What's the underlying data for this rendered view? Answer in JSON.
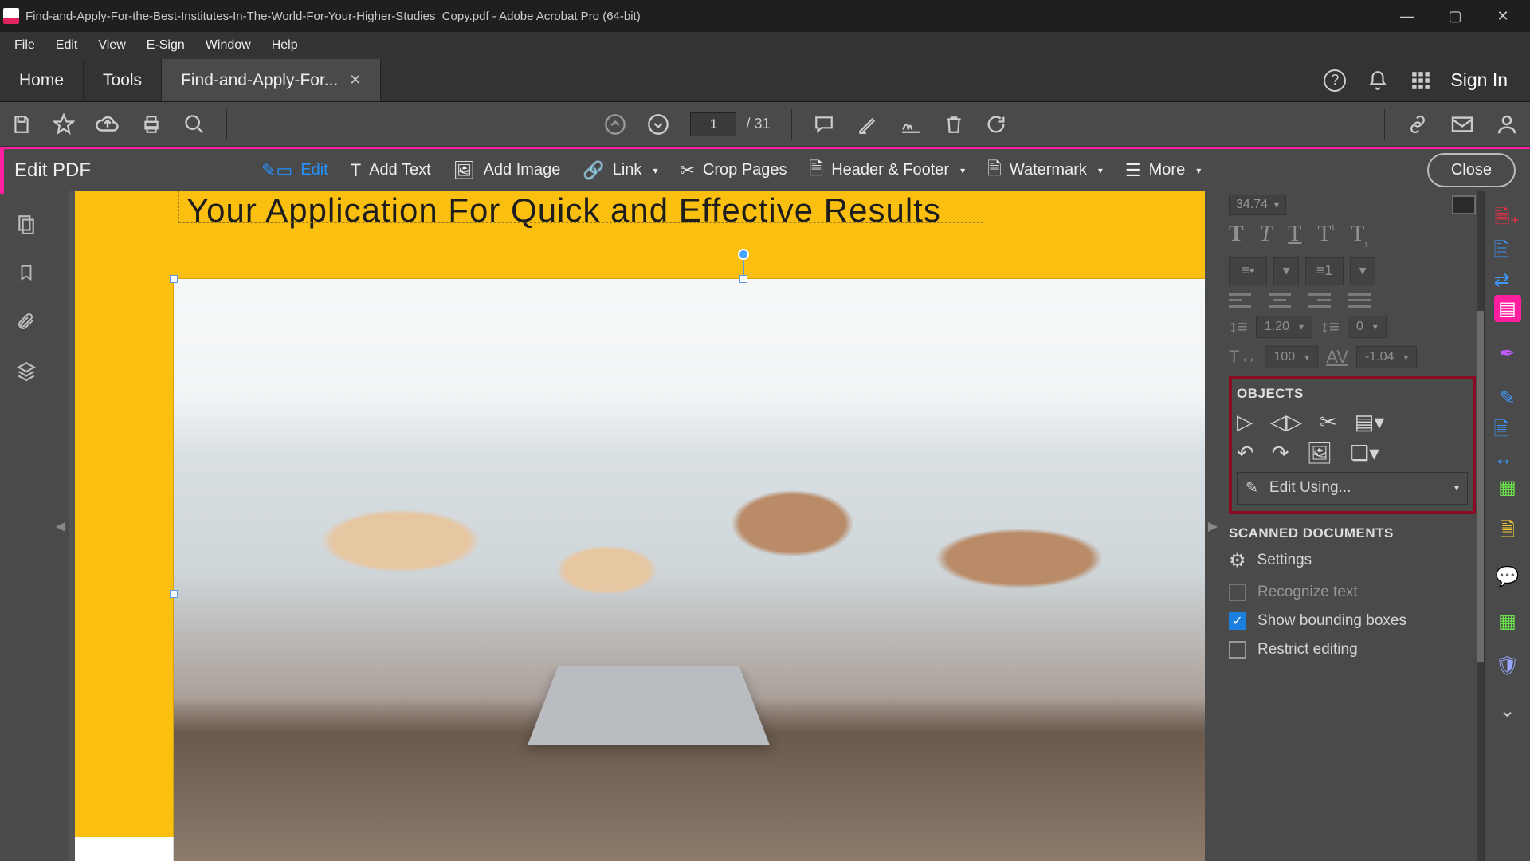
{
  "title": "Find-and-Apply-For-the-Best-Institutes-In-The-World-For-Your-Higher-Studies_Copy.pdf - Adobe Acrobat Pro (64-bit)",
  "menu": {
    "file": "File",
    "edit": "Edit",
    "view": "View",
    "esign": "E-Sign",
    "window": "Window",
    "help": "Help"
  },
  "tabs": {
    "home": "Home",
    "tools": "Tools",
    "doc": "Find-and-Apply-For..."
  },
  "sign_in": "Sign In",
  "page": {
    "current": "1",
    "total": "/ 31"
  },
  "editstrip": {
    "title": "Edit PDF",
    "edit": "Edit",
    "add_text": "Add Text",
    "add_image": "Add Image",
    "link": "Link",
    "crop": "Crop Pages",
    "header": "Header & Footer",
    "watermark": "Watermark",
    "more": "More",
    "close": "Close"
  },
  "doc_headline": "Your Application For Quick and Effective Results",
  "format": {
    "size": "34.74",
    "line": "1.20",
    "before": "0",
    "hscale": "100",
    "track": "-1.04"
  },
  "panel": {
    "objects": "OBJECTS",
    "edit_using": "Edit Using...",
    "scanned": "SCANNED DOCUMENTS",
    "settings": "Settings",
    "recognize": "Recognize text",
    "show_bb": "Show bounding boxes",
    "restrict": "Restrict editing"
  }
}
